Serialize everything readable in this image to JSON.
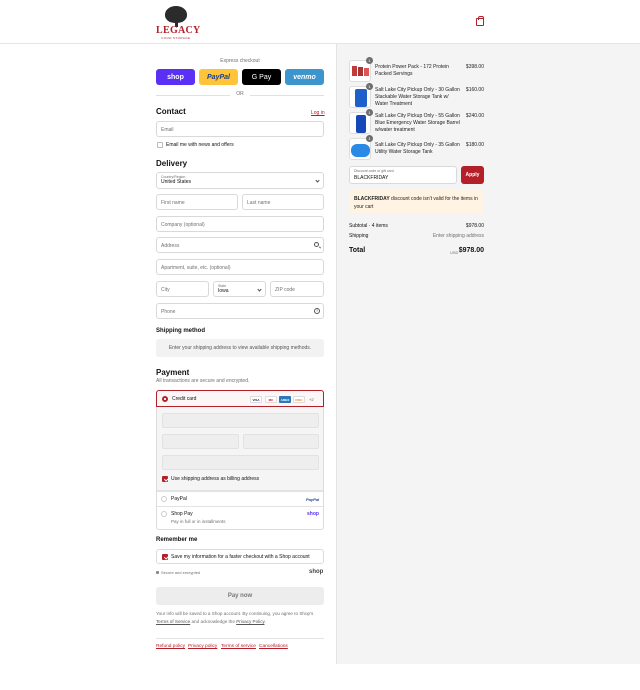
{
  "brand": {
    "name": "LEGACY",
    "tagline": "FOOD STORAGE"
  },
  "express": {
    "label": "Express checkout",
    "buttons": [
      "shop",
      "PayPal",
      "G Pay",
      "venmo"
    ],
    "or": "OR"
  },
  "contact": {
    "title": "Contact",
    "login": "Log in",
    "email_placeholder": "Email",
    "news_label": "Email me with news and offers"
  },
  "delivery": {
    "title": "Delivery",
    "country_label": "Country/Region",
    "country_value": "United States",
    "first_name": "First name",
    "last_name": "Last name",
    "company": "Company (optional)",
    "address": "Address",
    "apartment": "Apartment, suite, etc. (optional)",
    "city": "City",
    "state_label": "State",
    "state_value": "Iowa",
    "zip": "ZIP code",
    "phone": "Phone",
    "phone_help": "?"
  },
  "shipping": {
    "title": "Shipping method",
    "message": "Enter your shipping address to view available shipping methods."
  },
  "payment": {
    "title": "Payment",
    "subtitle": "All transactions are secure and encrypted.",
    "credit_card": "Credit card",
    "card_logos": [
      "VISA",
      "MC",
      "AMEX",
      "DISC",
      "+2"
    ],
    "billing_same": "Use shipping address as billing address",
    "paypal": "PayPal",
    "paypal_logo": "PayPal",
    "shop_pay": "Shop Pay",
    "shop_pay_sub": "Pay in full or in installments",
    "shop_logo": "shop"
  },
  "remember": {
    "title": "Remember me",
    "save_label": "Save my information for a faster checkout with a Shop account",
    "secure": "Secure and encrypted",
    "shop_logo": "shop"
  },
  "pay_now": "Pay now",
  "disclaimer": {
    "text1": "Your info will be saved to a Shop account. By continuing, you agree to Shop's",
    "tos": "Terms of Service",
    "text2": "and acknowledge the",
    "privacy": "Privacy Policy",
    "end": "."
  },
  "footer_links": [
    "Refund policy",
    "Privacy policy",
    "Terms of service",
    "Cancellations"
  ],
  "cart": {
    "items": [
      {
        "qty": "1",
        "name": "Protein Power Pack - 172 Protein Packed Servings",
        "price": "$398.00"
      },
      {
        "qty": "1",
        "name": "Salt Lake City Pickup Only - 30 Gallon Stackable Water Storage Tank w/ Water Treatment",
        "price": "$160.00"
      },
      {
        "qty": "1",
        "name": "Salt Lake City Pickup Only - 55 Gallon Blue Emergency Water Storage Barrel w/water treatment",
        "price": "$240.00"
      },
      {
        "qty": "1",
        "name": "Salt Lake City Pickup Only - 35 Gallon Utility Water Storage Tank",
        "price": "$180.00"
      }
    ],
    "discount_label": "Discount code or gift card",
    "discount_value": "BLACKFRIDAY",
    "apply": "Apply",
    "warning_code": "BLACKFRIDAY",
    "warning_text": "discount code isn't valid for the items in your cart",
    "subtotal_label": "Subtotal · 4 items",
    "subtotal_value": "$978.00",
    "shipping_label": "Shipping",
    "shipping_value": "Enter shipping address",
    "total_label": "Total",
    "currency": "USD",
    "total_value": "$978.00"
  },
  "colors": {
    "accent": "#b3202a",
    "shop": "#5a31f4",
    "paypal": "#ffc439",
    "venmo": "#3d95ce"
  }
}
